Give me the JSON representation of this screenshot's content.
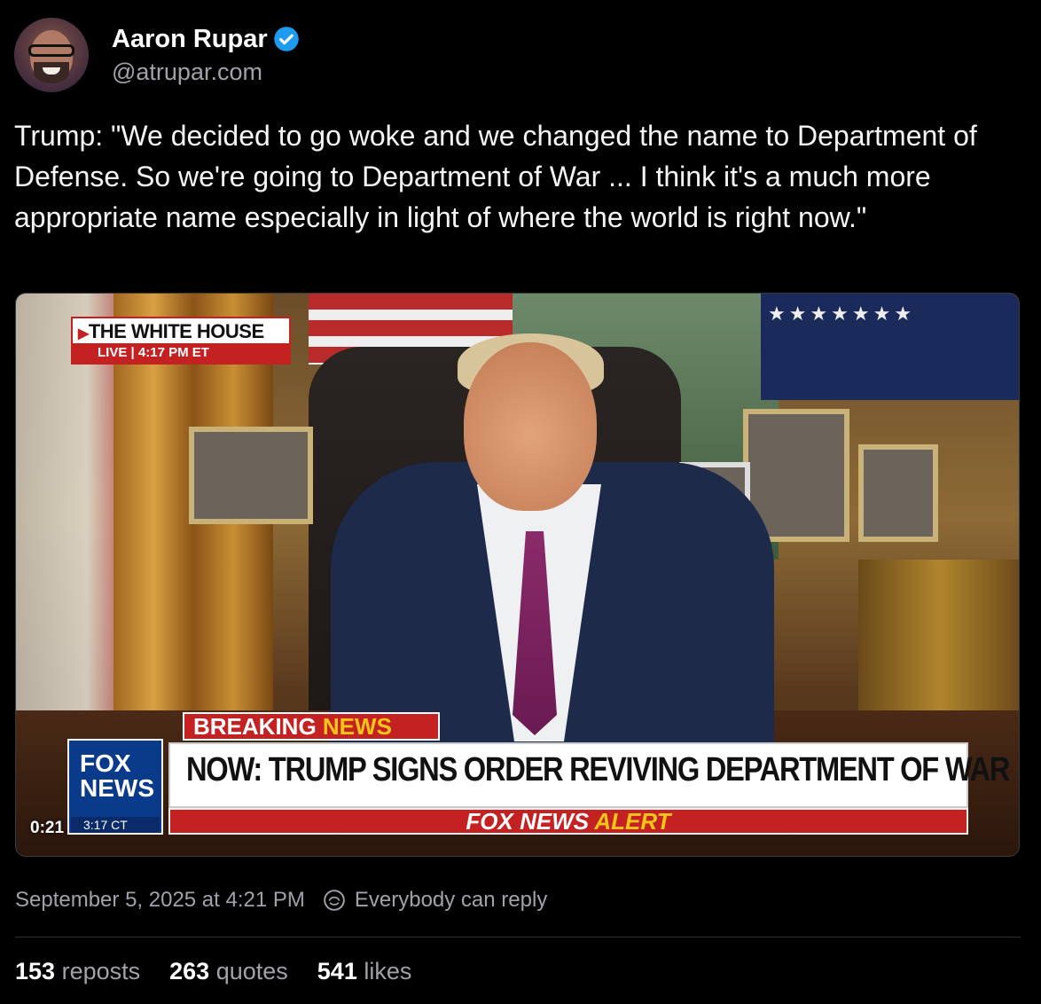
{
  "author": {
    "display_name": "Aaron Rupar",
    "handle": "@atrupar.com",
    "verified": true
  },
  "post": {
    "text": "Trump: \"We decided to go woke and we changed the name to Department of Defense. So we're going to Department of War ... I think it's a much more appropriate name especially in light of where the world is right now.\""
  },
  "video": {
    "elapsed": "0:21",
    "bug_white_house": "THE WHITE HOUSE",
    "bug_live": "LIVE",
    "bug_live_time": "4:17 PM ET",
    "breaking_1": "BREAKING",
    "breaking_2": "NEWS",
    "headline": "NOW: TRUMP SIGNS ORDER REVIVING DEPARTMENT OF WAR",
    "alert_1": "FOX NEWS",
    "alert_2": "ALERT",
    "logo_line1": "FOX",
    "logo_line2": "NEWS",
    "clock": "3:17 CT"
  },
  "meta": {
    "timestamp": "September 5, 2025 at 4:21 PM",
    "reply_setting": "Everybody can reply"
  },
  "stats": {
    "reposts_count": "153",
    "reposts_label": "reposts",
    "quotes_count": "263",
    "quotes_label": "quotes",
    "likes_count": "541",
    "likes_label": "likes"
  },
  "colors": {
    "background": "#000000",
    "verified_blue": "#1d9bf0",
    "muted_text": "#a1a1aa",
    "fox_red": "#c42222"
  }
}
